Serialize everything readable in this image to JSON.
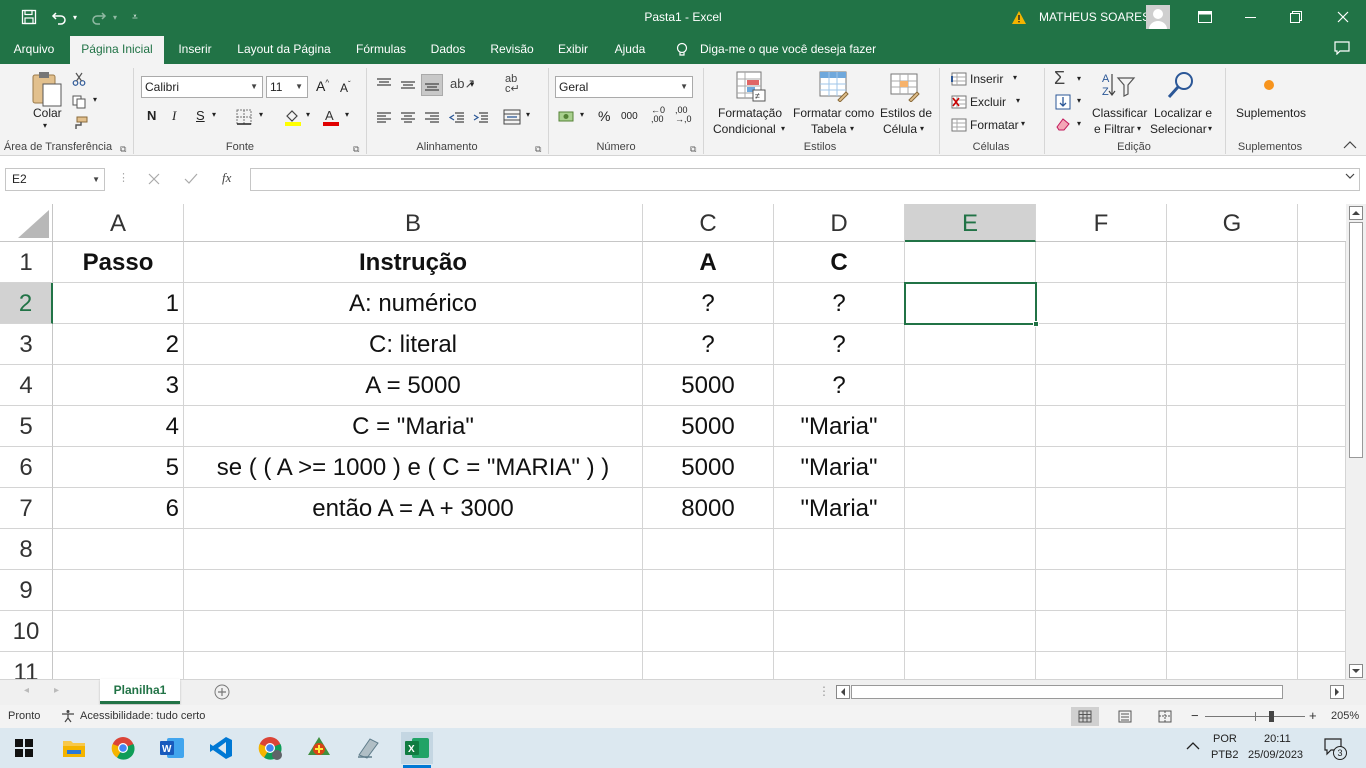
{
  "window": {
    "title": "Pasta1  -  Excel",
    "user": "MATHEUS SOARES"
  },
  "menu": {
    "tabs": [
      "Arquivo",
      "Página Inicial",
      "Inserir",
      "Layout da Página",
      "Fórmulas",
      "Dados",
      "Revisão",
      "Exibir",
      "Ajuda"
    ],
    "active": "Página Inicial",
    "tell_me": "Diga-me o que você deseja fazer"
  },
  "ribbon": {
    "clipboard": {
      "paste": "Colar",
      "label": "Área de Transferência"
    },
    "font": {
      "name": "Calibri",
      "size": "11",
      "bold": "N",
      "italic": "I",
      "underline": "S",
      "label": "Fonte"
    },
    "alignment": {
      "label": "Alinhamento"
    },
    "number": {
      "format": "Geral",
      "percent": "%",
      "thousands": "000",
      "label": "Número"
    },
    "styles": {
      "conditional": [
        "Formatação",
        "Condicional"
      ],
      "as_table": [
        "Formatar como",
        "Tabela"
      ],
      "cell_styles": [
        "Estilos de",
        "Célula"
      ],
      "label": "Estilos"
    },
    "cells": {
      "insert": "Inserir",
      "delete": "Excluir",
      "format": "Formatar",
      "label": "Células"
    },
    "editing": {
      "sort": [
        "Classificar",
        "e Filtrar"
      ],
      "find": [
        "Localizar e",
        "Selecionar"
      ],
      "label": "Edição"
    },
    "addins": {
      "button": "Suplementos",
      "label": "Suplementos"
    }
  },
  "formula_bar": {
    "name_box": "E2",
    "fx": "fx",
    "content": ""
  },
  "sheet": {
    "columns": [
      "A",
      "B",
      "C",
      "D",
      "E",
      "F",
      "G"
    ],
    "selected_column": "E",
    "rows": [
      "1",
      "2",
      "3",
      "4",
      "5",
      "6",
      "7",
      "8",
      "9",
      "10",
      "11"
    ],
    "selected_row": "2",
    "selected_cell": "E2",
    "data": [
      [
        "Passo",
        "Instrução",
        "A",
        "C"
      ],
      [
        "1",
        "A: numérico",
        "?",
        "?"
      ],
      [
        "2",
        "C: literal",
        "?",
        "?"
      ],
      [
        "3",
        "A = 5000",
        "5000",
        "?"
      ],
      [
        "4",
        "C = \"Maria\"",
        "5000",
        "\"Maria\""
      ],
      [
        "5",
        "se ( ( A >= 1000 ) e ( C = \"MARIA\" ) )",
        "5000",
        "\"Maria\""
      ],
      [
        "6",
        "então A = A + 3000",
        "8000",
        "\"Maria\""
      ]
    ]
  },
  "sheet_tabs": {
    "active": "Planilha1"
  },
  "status": {
    "ready": "Pronto",
    "accessibility": "Acessibilidade: tudo certo",
    "zoom": "205%",
    "zoom_minus": "−",
    "zoom_plus": "+"
  },
  "taskbar": {
    "lang1": "POR",
    "lang2": "PTB2",
    "time": "20:11",
    "date": "25/09/2023",
    "notifications": "3"
  },
  "colors": {
    "excel_green": "#217346",
    "selection_header": "#d2d2d2"
  }
}
